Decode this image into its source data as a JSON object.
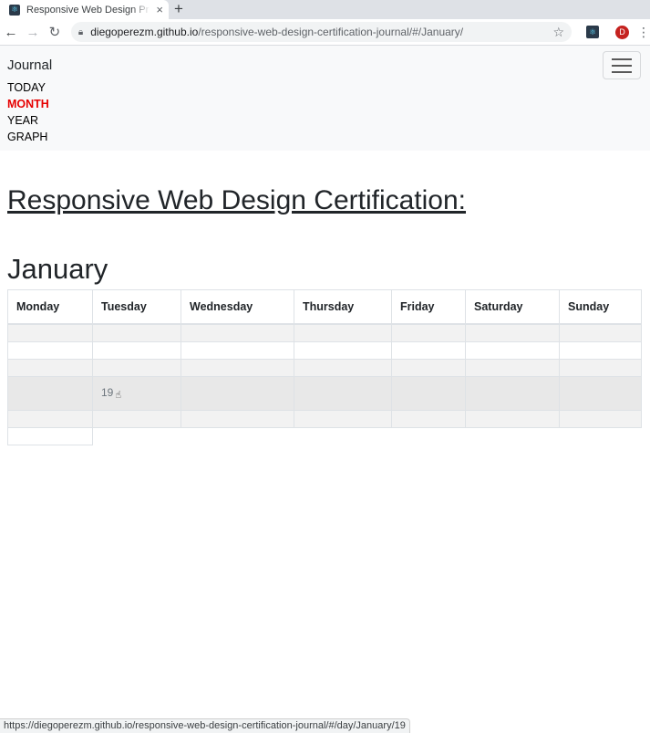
{
  "browser": {
    "tab_title": "Responsive Web Design Pr",
    "tab_close": "×",
    "new_tab": "+",
    "url_host": "diegoperezm.github.io",
    "url_path": "/responsive-web-design-certification-journal/#/January/",
    "avatar_letter": "D",
    "status_url": "https://diegoperezm.github.io/responsive-web-design-certification-journal/#/day/January/19"
  },
  "navbar": {
    "brand": "Journal",
    "links": [
      {
        "label": "TODAY"
      },
      {
        "label": "MONTH",
        "active": true
      },
      {
        "label": "YEAR"
      },
      {
        "label": "GRAPH"
      }
    ]
  },
  "main": {
    "title": "Responsive Web Design Certification:",
    "month": "January",
    "weekdays": [
      "Monday",
      "Tuesday",
      "Wednesday",
      "Thursday",
      "Friday",
      "Saturday",
      "Sunday"
    ],
    "highlight_day": "19"
  },
  "colors": {
    "active_link": "#e60000",
    "navbar_bg": "#f8f9fa"
  }
}
